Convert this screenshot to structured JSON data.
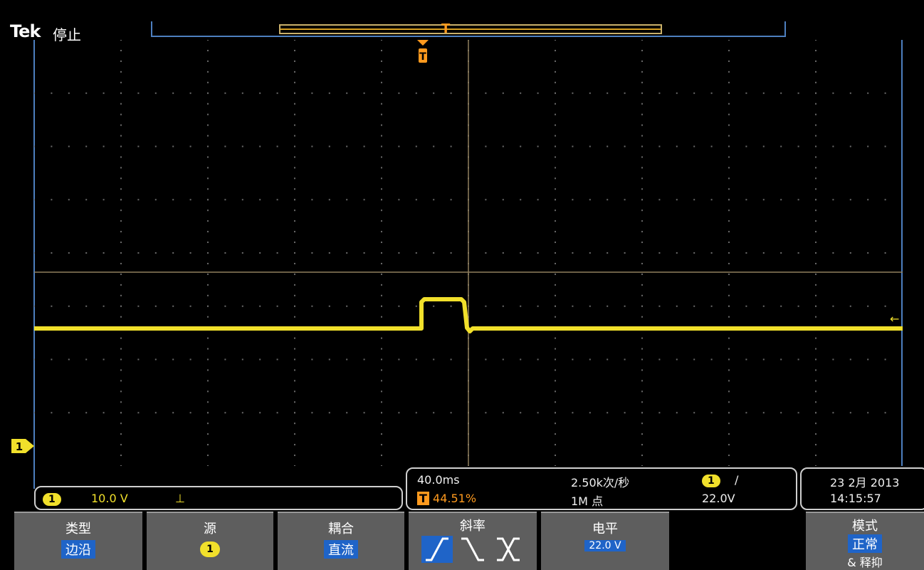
{
  "header": {
    "brand": "Tek",
    "acq_state": "停止",
    "record_trigger_mark": "T"
  },
  "colors": {
    "ch1": "#f1e02b",
    "trigger": "#ff9a1e",
    "frame": "#4d7fbf",
    "menu_bg": "#5e5e5e",
    "menu_value_bg": "#1f64c8"
  },
  "waveform": {
    "channel": "1",
    "trigger_level_arrow": "←"
  },
  "ch_readout": {
    "channel": "1",
    "scale": "10.0 V",
    "coupling": "⊥"
  },
  "timebase_readout": {
    "time_div": "40.0ms",
    "trigger_pos_icon": "T",
    "trigger_pos": "44.51%",
    "sample_rate": "2.50k次/秒",
    "record_length": "1M 点",
    "trig_channel": "1",
    "trig_slope": "/",
    "trig_level": "22.0V"
  },
  "date_readout": {
    "date": "23 2月 2013",
    "time": "14:15:57"
  },
  "menu": {
    "type": {
      "title": "类型",
      "value": "边沿"
    },
    "source": {
      "title": "源",
      "value": "1"
    },
    "coupling": {
      "title": "耦合",
      "value": "直流"
    },
    "slope": {
      "title": "斜率",
      "options": [
        "rising",
        "falling",
        "either"
      ],
      "selected": "rising"
    },
    "level": {
      "title": "电平",
      "value": "22.0 V"
    },
    "mode": {
      "title": "模式",
      "value": "正常",
      "sub": "& 释抑"
    }
  }
}
